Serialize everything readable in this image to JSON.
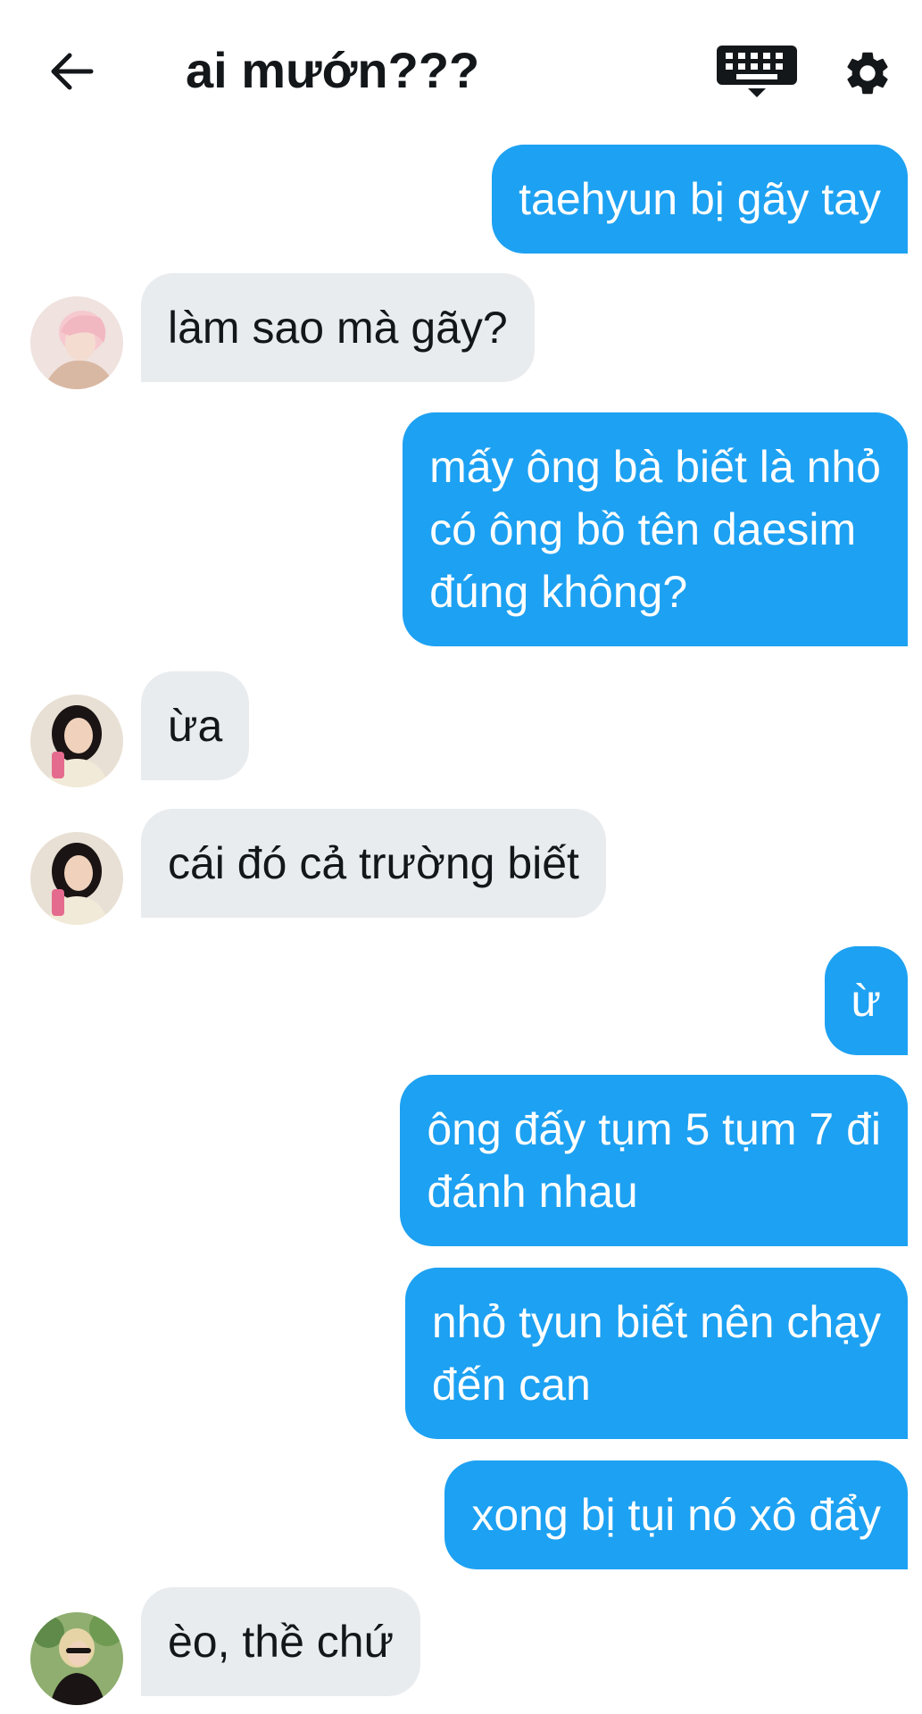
{
  "header": {
    "title": "ai mướn???",
    "back_icon": "arrow-left-icon",
    "keyboard_icon": "keyboard-icon",
    "settings_icon": "gear-icon"
  },
  "colors": {
    "accent": "#1da1f2",
    "incoming_bubble": "#e9ecef",
    "text": "#14171a"
  },
  "messages": [
    {
      "from": "me",
      "lines": [
        "taehyun bị gãy tay"
      ]
    },
    {
      "from": "them",
      "avatar": "avatar-pink-hair",
      "lines": [
        "làm sao mà gãy?"
      ]
    },
    {
      "from": "me",
      "lines": [
        "mấy ông bà biết là nhỏ",
        "có ông bồ tên daesim",
        "đúng không?"
      ]
    },
    {
      "from": "them",
      "avatar": "avatar-dark-hair",
      "lines": [
        "ừa"
      ]
    },
    {
      "from": "them",
      "avatar": "avatar-dark-hair",
      "lines": [
        "cái đó cả trường biết"
      ]
    },
    {
      "from": "me",
      "lines": [
        "ừ"
      ]
    },
    {
      "from": "me",
      "lines": [
        "ông đấy tụm 5 tụm 7 đi",
        "đánh nhau"
      ]
    },
    {
      "from": "me",
      "lines": [
        "nhỏ tyun biết nên chạy",
        "đến can"
      ]
    },
    {
      "from": "me",
      "lines": [
        "xong bị tụi nó xô đẩy"
      ]
    },
    {
      "from": "them",
      "avatar": "avatar-outdoor",
      "lines": [
        "èo, thề chứ"
      ]
    }
  ]
}
